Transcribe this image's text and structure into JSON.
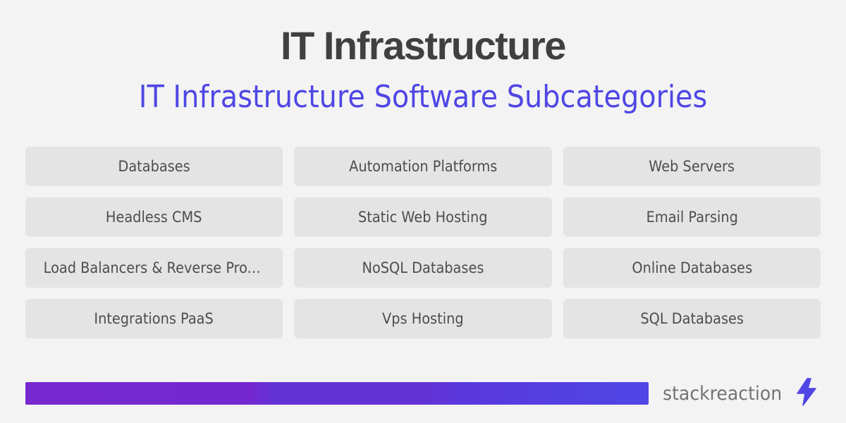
{
  "header": {
    "title": "IT Infrastructure",
    "subtitle": "IT Infrastructure Software Subcategories"
  },
  "subcategories": [
    {
      "label": "Databases"
    },
    {
      "label": "Automation Platforms"
    },
    {
      "label": "Web Servers"
    },
    {
      "label": "Headless CMS"
    },
    {
      "label": "Static Web Hosting"
    },
    {
      "label": "Email Parsing"
    },
    {
      "label": "Load Balancers & Reverse Proxies"
    },
    {
      "label": "NoSQL Databases"
    },
    {
      "label": "Online Databases"
    },
    {
      "label": "Integrations PaaS"
    },
    {
      "label": "Vps Hosting"
    },
    {
      "label": "SQL Databases"
    }
  ],
  "footer": {
    "brand_name": "stackreaction",
    "brand_icon": "lightning-bolt-icon",
    "colors": {
      "accent": "#4f46e5",
      "gradient_start": "#7627d0",
      "gradient_end": "#4f46e5"
    }
  }
}
